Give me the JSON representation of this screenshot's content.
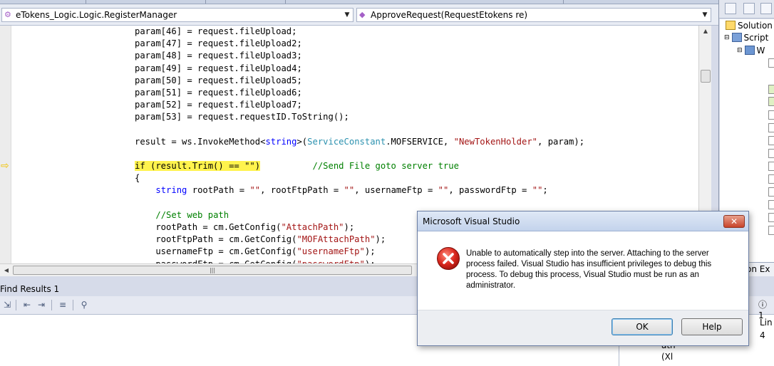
{
  "navigation": {
    "class_combo": "eTokens_Logic.Logic.RegisterManager",
    "member_combo": "ApproveRequest(RequestEtokens re)"
  },
  "code_lines": [
    [
      {
        "t": "param[46] = request.fileUpload;",
        "c": ""
      }
    ],
    [
      {
        "t": "param[47] = request.fileUpload2;",
        "c": ""
      }
    ],
    [
      {
        "t": "param[48] = request.fileUpload3;",
        "c": ""
      }
    ],
    [
      {
        "t": "param[49] = request.fileUpload4;",
        "c": ""
      }
    ],
    [
      {
        "t": "param[50] = request.fileUpload5;",
        "c": ""
      }
    ],
    [
      {
        "t": "param[51] = request.fileUpload6;",
        "c": ""
      }
    ],
    [
      {
        "t": "param[52] = request.fileUpload7;",
        "c": ""
      }
    ],
    [
      {
        "t": "param[53] = request.requestID.ToString();",
        "c": ""
      }
    ],
    [],
    [
      {
        "t": "result = ws.InvokeMethod<",
        "c": ""
      },
      {
        "t": "string",
        "c": "kw"
      },
      {
        "t": ">(",
        "c": ""
      },
      {
        "t": "ServiceConstant",
        "c": "typ"
      },
      {
        "t": ".MOFSERVICE, ",
        "c": ""
      },
      {
        "t": "\"NewTokenHolder\"",
        "c": "str"
      },
      {
        "t": ", param);",
        "c": ""
      }
    ],
    [],
    [
      {
        "t": "if (result.Trim() == \"\")",
        "c": "hl"
      },
      {
        "t": "          ",
        "c": ""
      },
      {
        "t": "//Send File goto server true",
        "c": "cmt"
      }
    ],
    [
      {
        "t": "{",
        "c": ""
      }
    ],
    [
      {
        "t": "    ",
        "c": ""
      },
      {
        "t": "string",
        "c": "kw"
      },
      {
        "t": " rootPath = ",
        "c": ""
      },
      {
        "t": "\"\"",
        "c": "str"
      },
      {
        "t": ", rootFtpPath = ",
        "c": ""
      },
      {
        "t": "\"\"",
        "c": "str"
      },
      {
        "t": ", usernameFtp = ",
        "c": ""
      },
      {
        "t": "\"\"",
        "c": "str"
      },
      {
        "t": ", passwordFtp = ",
        "c": ""
      },
      {
        "t": "\"\"",
        "c": "str"
      },
      {
        "t": ";",
        "c": ""
      }
    ],
    [],
    [
      {
        "t": "    ",
        "c": ""
      },
      {
        "t": "//Set web path",
        "c": "cmt"
      }
    ],
    [
      {
        "t": "    rootPath = cm.GetConfig(",
        "c": ""
      },
      {
        "t": "\"AttachPath\"",
        "c": "str"
      },
      {
        "t": ");",
        "c": ""
      }
    ],
    [
      {
        "t": "    rootFtpPath = cm.GetConfig(",
        "c": ""
      },
      {
        "t": "\"MOFAttachPath\"",
        "c": "str"
      },
      {
        "t": ");",
        "c": ""
      }
    ],
    [
      {
        "t": "    usernameFtp = cm.GetConfig(",
        "c": ""
      },
      {
        "t": "\"usernameFtp\"",
        "c": "str"
      },
      {
        "t": ");",
        "c": ""
      }
    ],
    [
      {
        "t": "    passwordFtp = cm.GetConfig(",
        "c": ""
      },
      {
        "t": "\"passwordFtp\"",
        "c": "str"
      },
      {
        "t": ");",
        "c": ""
      }
    ]
  ],
  "solution_explorer": {
    "tree_items": [
      "Solution",
      "Script",
      "W"
    ],
    "tab_label": "tion Ex"
  },
  "find_results": {
    "title": "Find Results 1"
  },
  "error_list": {
    "info_count": "1",
    "column_header": "Lin",
    "column_value": "4",
    "snippets": [
      "ath",
      "(Xl"
    ]
  },
  "dialog": {
    "title": "Microsoft Visual Studio",
    "close": "✕",
    "message": "Unable to automatically step into the server. Attaching to the server process failed. Visual Studio has insufficient privileges to debug this process. To debug this process, Visual Studio must be run as an administrator.",
    "ok_label": "OK",
    "help_label": "Help",
    "icon": "error-icon"
  },
  "colors": {
    "keyword": "#0000ff",
    "string": "#a31515",
    "type": "#2b91af",
    "comment": "#008000",
    "highlight": "#fff34d"
  }
}
